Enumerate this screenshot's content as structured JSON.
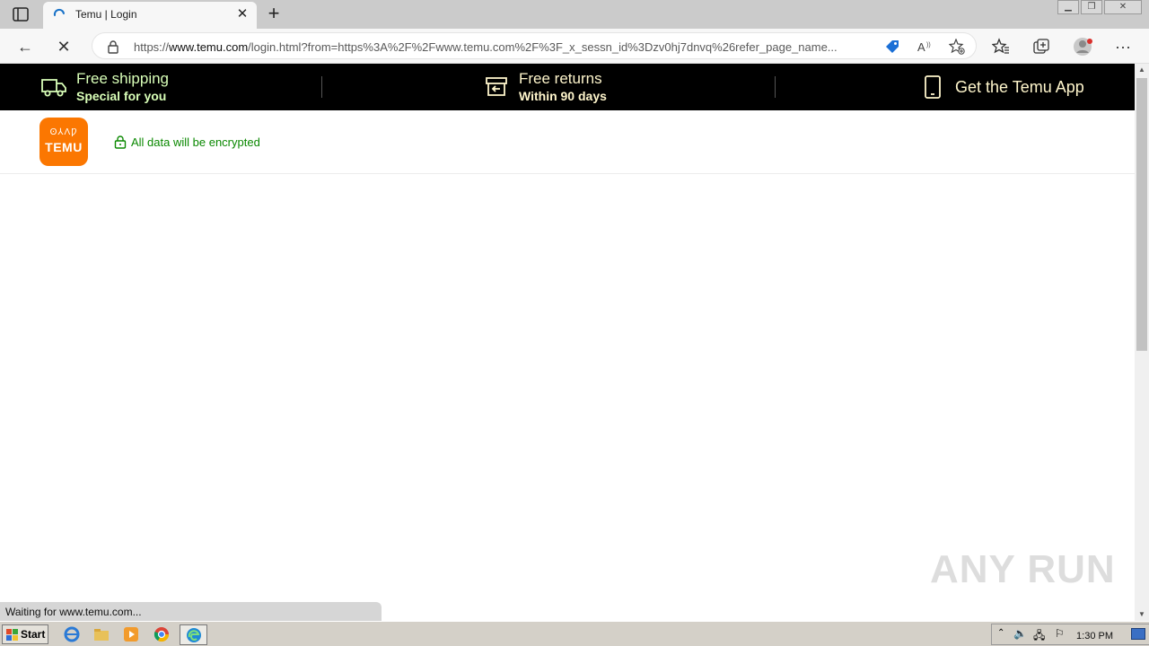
{
  "browser": {
    "tab_title": "Temu | Login",
    "new_tab": "+",
    "url_prefix": "https://",
    "url_host": "www.temu.com",
    "url_rest": "/login.html?from=https%3A%2F%2Fwww.temu.com%2F%3F_x_sessn_id%3Dzv0hj7dnvq%26refer_page_name...",
    "status": "Waiting for www.temu.com..."
  },
  "promo": {
    "shipping_title": "Free shipping",
    "shipping_sub": "Special for you",
    "returns_title": "Free returns",
    "returns_sub": "Within 90 days",
    "app_title": "Get the Temu App"
  },
  "header": {
    "logo_text": "TEMU",
    "logo_glyphs": "ʘ⅄ɅǷ",
    "encrypt_text": "All data will be encrypted"
  },
  "watermark": "ANY RUN",
  "taskbar": {
    "start": "Start",
    "clock": "1:30 PM"
  },
  "colors": {
    "brand": "#fb7701",
    "encrypt_green": "#0a8800",
    "promo_bg": "#000000"
  }
}
